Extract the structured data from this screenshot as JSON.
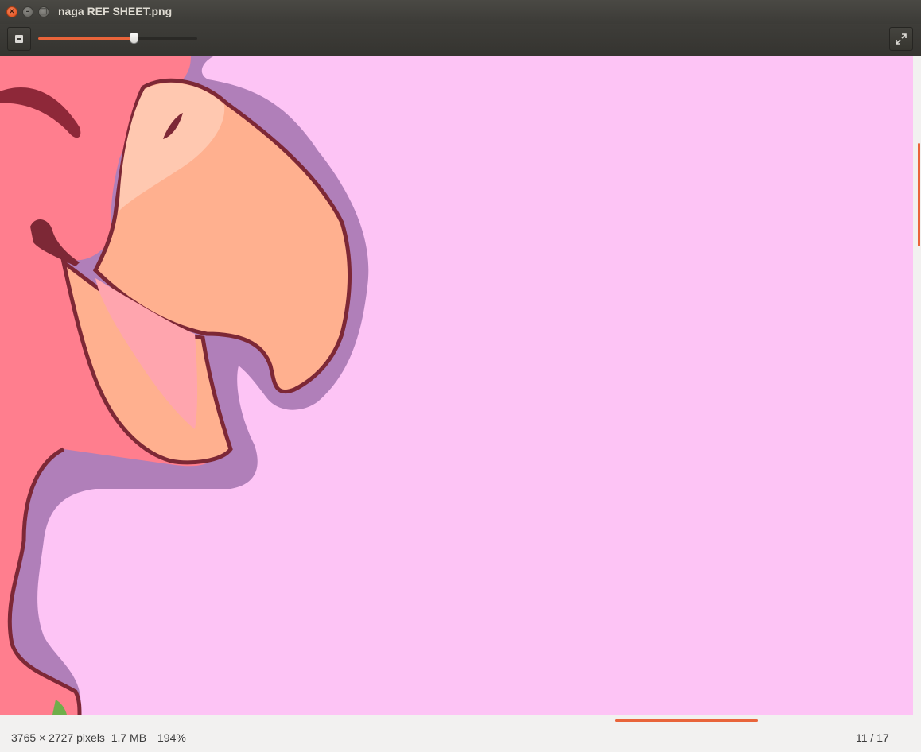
{
  "window": {
    "title": "naga REF SHEET.png",
    "controls": {
      "close": "×",
      "minimize": "–",
      "maximize": "□"
    }
  },
  "toolbar": {
    "zoom_out_icon": "minus-icon",
    "zoom_slider_level": 0.6,
    "fullscreen_icon": "fullscreen-icon",
    "accent_color": "#e9643a"
  },
  "image": {
    "background_color": "#fdc4f5",
    "content": "zoomed character artwork (pink creature head with orange beak)"
  },
  "scrollbars": {
    "vertical_color": "#e9643a",
    "horizontal_color": "#e9643a"
  },
  "statusbar": {
    "dimensions_size": "3765 × 2727 pixels  1.7 MB",
    "zoom": "194%",
    "position": "11 / 17"
  }
}
